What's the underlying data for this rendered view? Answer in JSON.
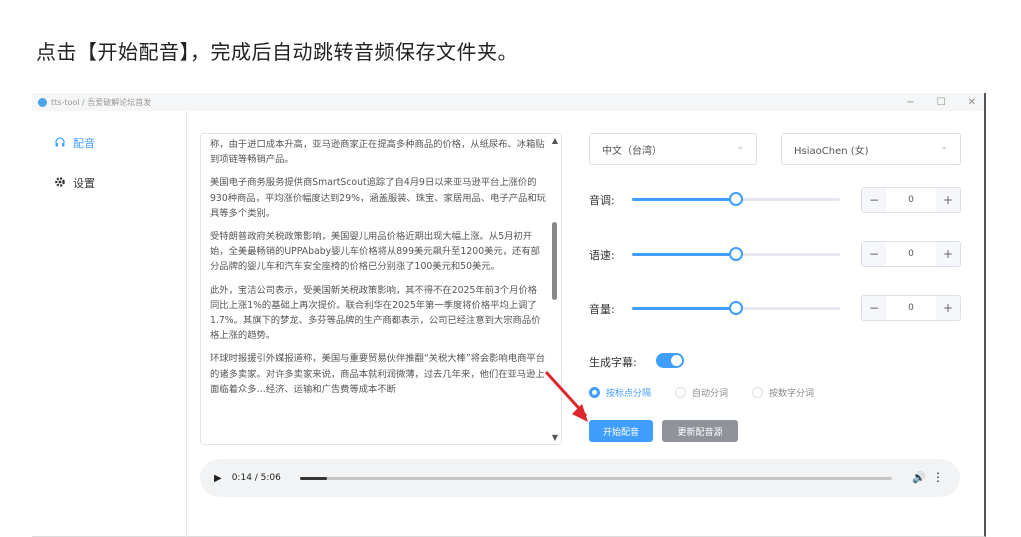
{
  "caption": "点击【开始配音】，完成后自动跳转音频保存文件夹。",
  "window": {
    "title": "tts-tool / 吾爱破解论坛首发",
    "minimize_symbol": "−",
    "maximize_symbol": "☐",
    "close_symbol": "✕"
  },
  "sidebar": {
    "items": [
      {
        "label": "配音",
        "icon": "headphones-icon",
        "active": true
      },
      {
        "label": "设置",
        "icon": "gear-icon",
        "active": false
      }
    ]
  },
  "editor": {
    "paragraphs": [
      "称，由于进口成本升高，亚马逊商家正在提高多种商品的价格，从纸尿布、冰箱贴到项链等畅销产品。",
      "美国电子商务服务提供商SmartScout追踪了自4月9日以来亚马逊平台上涨价的930种商品，平均涨价幅度达到29%，涵盖服装、珠宝、家居用品、电子产品和玩具等多个类别。",
      "受特朗普政府关税政策影响，美国婴儿用品价格近期出现大幅上涨。从5月初开始，全美最畅销的UPPAbaby婴儿车价格将从899美元飙升至1200美元，还有部分品牌的婴儿车和汽车安全座椅的价格已分别涨了100美元和50美元。",
      "此外，宝洁公司表示，受美国新关税政策影响，其不得不在2025年前3个月价格同比上涨1%的基础上再次提价。联合利华在2025年第一季度将价格平均上调了1.7%。其旗下的梦龙、多芬等品牌的生产商都表示，公司已经注意到大宗商品价格上涨的趋势。",
      "环球时报援引外媒报道称，美国与重要贸易伙伴推翻“关税大棒”将会影响电商平台的诸多卖家。对许多卖家来说，商品本就利润微薄，过去几年来，他们在亚马逊上面临着众多…经济、运输和广告费等成本不断"
    ]
  },
  "voice": {
    "language": "中文（台湾）",
    "speaker": "HsiaoChen (女)"
  },
  "controls": [
    {
      "label": "音调:",
      "value": "0",
      "slider_fraction": 0.5
    },
    {
      "label": "语速:",
      "value": "0",
      "slider_fraction": 0.5
    },
    {
      "label": "音量:",
      "value": "0",
      "slider_fraction": 0.5
    }
  ],
  "subtitles": {
    "label": "生成字幕:",
    "enabled": true,
    "options": [
      "按标点分隔",
      "自动分词",
      "按数字分词"
    ],
    "selected_index": 0
  },
  "buttons": {
    "start": "开始配音",
    "update": "更新配音源"
  },
  "audio": {
    "time": "0:14 / 5:06",
    "progress_fraction": 0.046
  },
  "colors": {
    "accent": "#409eff",
    "arrow": "#e0262d",
    "secondary_button": "#909399"
  }
}
